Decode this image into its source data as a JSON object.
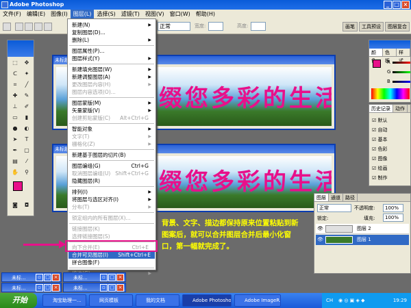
{
  "app_title": "Adobe Photoshop",
  "menubar": [
    "文件(F)",
    "编辑(E)",
    "图像(I)",
    "图层(L)",
    "选择(S)",
    "滤镜(T)",
    "视图(V)",
    "窗口(W)",
    "帮助(H)"
  ],
  "options": {
    "mode": "正常",
    "width_label": "宽度:",
    "height_label": "高度:",
    "tabs": [
      "画笔",
      "工具预设",
      "图层复合"
    ]
  },
  "layer_menu": [
    {
      "label": "新建(N)",
      "arrow": true
    },
    {
      "label": "复制图层(D)..."
    },
    {
      "label": "删除(L)",
      "arrow": true
    },
    {
      "sep": true
    },
    {
      "label": "图层属性(P)..."
    },
    {
      "label": "图层样式(Y)",
      "arrow": true
    },
    {
      "sep": true
    },
    {
      "label": "新建填充图层(W)",
      "arrow": true
    },
    {
      "label": "新建调整图层(A)",
      "arrow": true
    },
    {
      "label": "更改图层内容(H)",
      "arrow": true,
      "disabled": true
    },
    {
      "label": "图层内容选项(O)...",
      "disabled": true
    },
    {
      "sep": true
    },
    {
      "label": "图层蒙版(M)",
      "arrow": true
    },
    {
      "label": "矢量蒙版(V)",
      "arrow": true
    },
    {
      "label": "创建剪贴蒙版(C)",
      "shortcut": "Alt+Ctrl+G",
      "disabled": true
    },
    {
      "sep": true
    },
    {
      "label": "智能对象",
      "arrow": true
    },
    {
      "label": "文字(T)",
      "arrow": true,
      "disabled": true
    },
    {
      "label": "栅格化(Z)",
      "arrow": true,
      "disabled": true
    },
    {
      "sep": true
    },
    {
      "label": "新建基于图层的切片(B)"
    },
    {
      "sep": true
    },
    {
      "label": "图层编组(G)",
      "shortcut": "Ctrl+G"
    },
    {
      "label": "取消图层编组(U)",
      "shortcut": "Shift+Ctrl+G",
      "disabled": true
    },
    {
      "label": "隐藏图层(R)"
    },
    {
      "sep": true
    },
    {
      "label": "排列(I)",
      "arrow": true
    },
    {
      "label": "将图层与选区对齐(I)",
      "arrow": true
    },
    {
      "label": "分布(T)",
      "arrow": true,
      "disabled": true
    },
    {
      "sep": true
    },
    {
      "label": "锁定组内的所有图层(X)...",
      "disabled": true
    },
    {
      "sep": true
    },
    {
      "label": "链接图层(K)",
      "disabled": true
    },
    {
      "label": "选择链接图层(S)",
      "disabled": true
    },
    {
      "sep": true
    },
    {
      "label": "向下合并(E)",
      "shortcut": "Ctrl+E",
      "disabled": true
    },
    {
      "label": "合并可见图层(I)",
      "shortcut": "Shift+Ctrl+E",
      "highlight": true
    },
    {
      "label": "拼合图像(F)"
    },
    {
      "sep": true
    },
    {
      "label": "修边(G)",
      "arrow": true,
      "disabled": true
    }
  ],
  "document": {
    "title": "未标题",
    "slogan": "缀您多彩的生活"
  },
  "note": "背景、文字、描边都保持原来位置粘贴到新图案后，就可以合并图层合并后最小化窗口，第一幅就完成了。",
  "color_panel": {
    "tabs": [
      "颜色",
      "色板",
      "样式"
    ],
    "channels": [
      "R",
      "G",
      "B"
    ]
  },
  "history_panel": {
    "tabs": [
      "历史记录",
      "动作"
    ],
    "items": [
      "默认",
      "自动",
      "基本",
      "色彩",
      "图像",
      "绘画",
      "制作"
    ]
  },
  "layers_panel": {
    "tabs": [
      "图层",
      "通道",
      "路径"
    ],
    "blend_mode": "正常",
    "opacity_label": "不透明度:",
    "opacity": "100%",
    "lock_label": "锁定:",
    "fill_label": "填充:",
    "fill": "100%",
    "layers": [
      {
        "name": "图层 2"
      },
      {
        "name": "图层 1"
      }
    ]
  },
  "minimized_windows": [
    "未标...",
    "未标...",
    "未标...",
    "未标..."
  ],
  "taskbar": {
    "start": "开始",
    "tasks": [
      "淘宝助理一...",
      "网页模板",
      "我的文档",
      "Adobe Photoshop",
      "Adobe ImageR..."
    ],
    "lang": "CH",
    "clock": "19:29"
  }
}
